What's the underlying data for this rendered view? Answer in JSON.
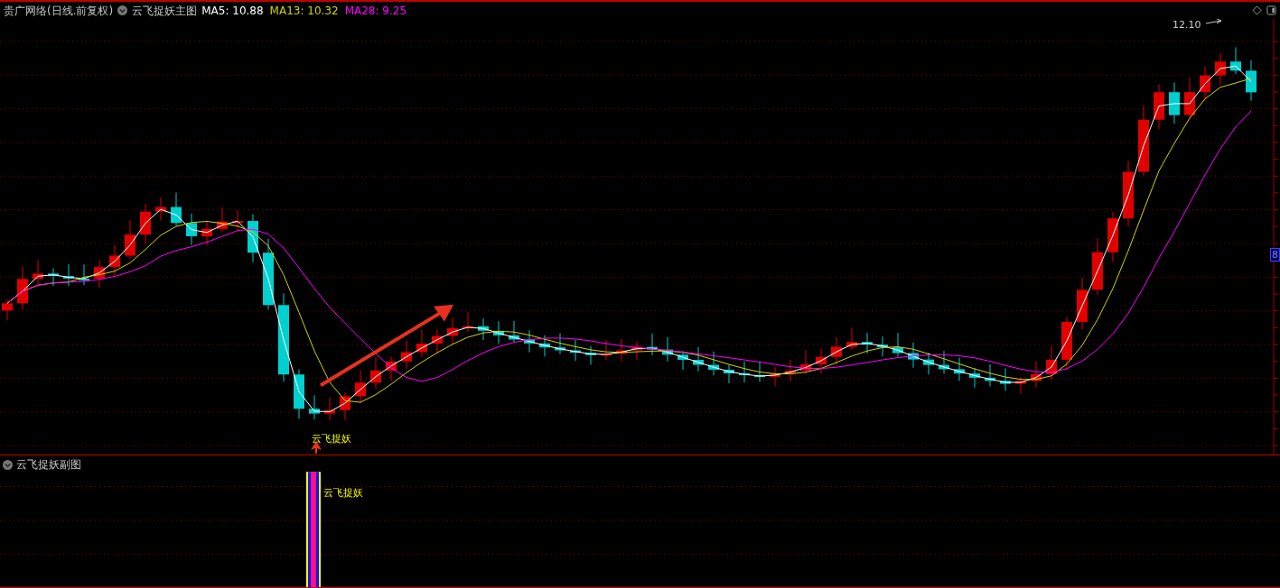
{
  "header": {
    "title": "贵广网络(日线.前复权)",
    "indicator": "云飞捉妖主图",
    "legend": [
      {
        "label": "MA5: 10.88",
        "color": "#ffffff"
      },
      {
        "label": "MA13: 10.32",
        "color": "#d4d400"
      },
      {
        "label": "MA28: 9.25",
        "color": "#ff00ff"
      }
    ]
  },
  "main_chart": {
    "high_label": "12.10",
    "signal_label": "云飞捉妖",
    "axis_label": "8"
  },
  "sub_panel": {
    "title": "云飞捉妖副图",
    "signal_label": "云飞捉妖"
  }
}
